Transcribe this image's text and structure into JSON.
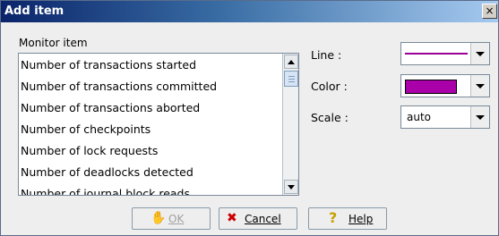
{
  "window": {
    "title": "Add item",
    "close_glyph": "×"
  },
  "monitor": {
    "label": "Monitor item",
    "items": [
      "Number of transactions started",
      "Number of transactions committed",
      "Number of transactions aborted",
      "Number of checkpoints",
      "Number of lock requests",
      "Number of deadlocks detected",
      "Number of journal block reads"
    ]
  },
  "line": {
    "label": "Line :",
    "color": "#990099"
  },
  "color": {
    "label": "Color :",
    "value": "#aa00aa"
  },
  "scale": {
    "label": "Scale :",
    "value": "auto"
  },
  "buttons": {
    "ok_label": "OK",
    "cancel_label": "Cancel",
    "help_label": "Help"
  },
  "icons": {
    "ok": "hand-icon",
    "cancel": "x-icon",
    "help": "question-icon"
  }
}
